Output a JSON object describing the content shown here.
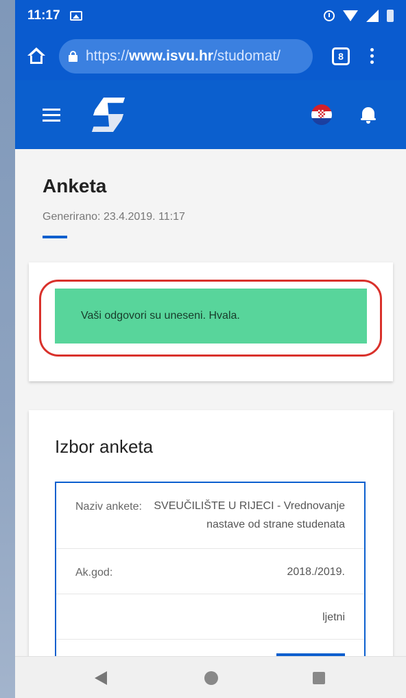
{
  "status_bar": {
    "time": "11:17",
    "icons": [
      "image-icon",
      "alarm-icon",
      "wifi-icon",
      "signal-icon",
      "battery-icon"
    ]
  },
  "browser": {
    "url_prefix": "https://",
    "url_domain": "www.isvu.hr",
    "url_path": "/studomat/",
    "tab_count": "8"
  },
  "app_header": {
    "icons": [
      "hamburger-icon",
      "studomat-logo",
      "croatian-flag-icon",
      "bell-icon"
    ]
  },
  "page": {
    "title": "Anketa",
    "generated": "Generirano: 23.4.2019. 11:17"
  },
  "message": {
    "text": "Vaši odgovori su uneseni. Hvala."
  },
  "survey": {
    "title": "Izbor anketa",
    "rows": [
      {
        "label": "Naziv ankete:",
        "value": "SVEUČILIŠTE U RIJECI - Vrednovanje nastave od strane studenata"
      },
      {
        "label": "Ak.god:",
        "value": "2018./2019."
      },
      {
        "label": "",
        "value": "ljetni"
      }
    ]
  },
  "colors": {
    "primary": "#0b5fce",
    "success": "#58d59b",
    "highlight": "#d9312b"
  }
}
